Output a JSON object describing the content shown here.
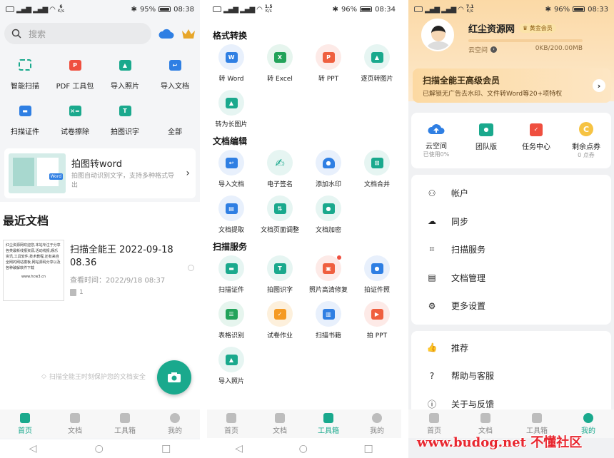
{
  "s1": {
    "status": {
      "left": "• • •",
      "speed_num": "6",
      "speed_unit": "K/s",
      "battery": "95%",
      "time": "08:38"
    },
    "search_placeholder": "搜索",
    "tools": [
      {
        "label": "智能扫描"
      },
      {
        "label": "PDF 工具包"
      },
      {
        "label": "导入照片"
      },
      {
        "label": "导入文档"
      },
      {
        "label": "扫描证件"
      },
      {
        "label": "试卷擦除"
      },
      {
        "label": "拍图识字"
      },
      {
        "label": "全部"
      }
    ],
    "promo": {
      "title": "拍图转word",
      "desc": "拍图自动识别文字，支持多种格式导出",
      "thumb_badge": "Word"
    },
    "recent_title": "最近文档",
    "doc": {
      "title": "扫描全能王 2022-09-18 08.36",
      "time": "查看时间：2022/9/18 08:37",
      "pages": "1",
      "thumb_text": "红尘资源网欢迎您,本站专注于分享各类最新线报资源,活动线报,娱乐资讯,工具软件,技术教程,还有来自全网的网站模板,网站源码分享以及各种破解软件下载",
      "thumb_url": "www.hcw3.cn"
    },
    "footer_note": "扫描全能王时刻保护您的文档安全",
    "nav": [
      "首页",
      "文档",
      "工具箱",
      "我的"
    ]
  },
  "s2": {
    "status": {
      "speed_num": "1.5",
      "speed_unit": "K/s",
      "battery": "96%",
      "time": "08:34"
    },
    "sections": [
      {
        "title": "格式转换",
        "items": [
          "转 Word",
          "转 Excel",
          "转 PPT",
          "逐页转图片",
          "转为长图片"
        ]
      },
      {
        "title": "文档编辑",
        "items": [
          "导入文档",
          "电子签名",
          "添加水印",
          "文档合并",
          "文档提取",
          "文档页面调整",
          "文档加密"
        ]
      },
      {
        "title": "扫描服务",
        "items": [
          "扫描证件",
          "拍图识字",
          "照片高清修复",
          "拍证件照",
          "表格识别",
          "试卷作业",
          "扫描书籍",
          "拍 PPT",
          "导入照片"
        ]
      }
    ],
    "nav": [
      "首页",
      "文档",
      "工具箱",
      "我的"
    ]
  },
  "s3": {
    "status": {
      "speed_num": "7.1",
      "speed_unit": "K/s",
      "battery": "96%",
      "time": "08:33"
    },
    "user": {
      "name": "红尘资源网",
      "badge": "黄金会员",
      "cloud_label": "云空间",
      "storage": "0KB/200.00MB"
    },
    "vip": {
      "title": "扫描全能王高级会员",
      "desc": "已解锁无广告去水印、文件转Word等20+项特权"
    },
    "quick": [
      {
        "label": "云空间",
        "sub": "已使用0%"
      },
      {
        "label": "团队版",
        "sub": ""
      },
      {
        "label": "任务中心",
        "sub": ""
      },
      {
        "label": "剩余点券",
        "sub": "0 点券"
      }
    ],
    "menu1": [
      "帐户",
      "同步",
      "扫描服务",
      "文档管理",
      "更多设置"
    ],
    "menu2": [
      "推荐",
      "帮助与客服",
      "关于与反馈"
    ],
    "nav": [
      "首页",
      "文档",
      "工具箱",
      "我的"
    ]
  },
  "watermark": {
    "url": "www.budog.net",
    "name": "不懂社区"
  },
  "colors": {
    "accent": "#1aa98d",
    "orange": "#f59a23",
    "red": "#ef4f3f",
    "blue": "#2f7fe3",
    "vip_bg": "#fde6c4"
  }
}
